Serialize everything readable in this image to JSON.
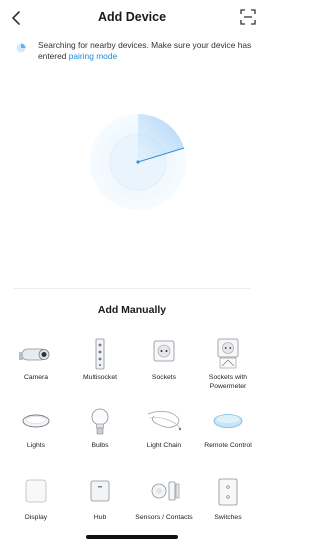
{
  "header": {
    "title": "Add Device"
  },
  "notice": {
    "text": "Searching for nearby devices. Make sure your device has entered",
    "link": "pairing mode"
  },
  "colors": {
    "accent": "#1b8bd8",
    "radar": "#3b9ee8"
  },
  "manual": {
    "title": "Add Manually",
    "items": [
      {
        "label": "Camera",
        "icon": "camera-icon"
      },
      {
        "label": "Multisocket",
        "icon": "multisocket-icon"
      },
      {
        "label": "Sockets",
        "icon": "socket-icon"
      },
      {
        "label": "Sockets with Powermeter",
        "icon": "socket-powermeter-icon"
      },
      {
        "label": "Lights",
        "icon": "ceiling-light-icon"
      },
      {
        "label": "Bulbs",
        "icon": "bulb-icon"
      },
      {
        "label": "Light Chain",
        "icon": "light-chain-icon"
      },
      {
        "label": "Remote Control",
        "icon": "remote-icon"
      },
      {
        "label": "Display",
        "icon": "display-icon"
      },
      {
        "label": "Hub",
        "icon": "hub-icon"
      },
      {
        "label": "Sensors / Contacts",
        "icon": "sensor-icon"
      },
      {
        "label": "Switches",
        "icon": "switch-icon"
      }
    ]
  }
}
